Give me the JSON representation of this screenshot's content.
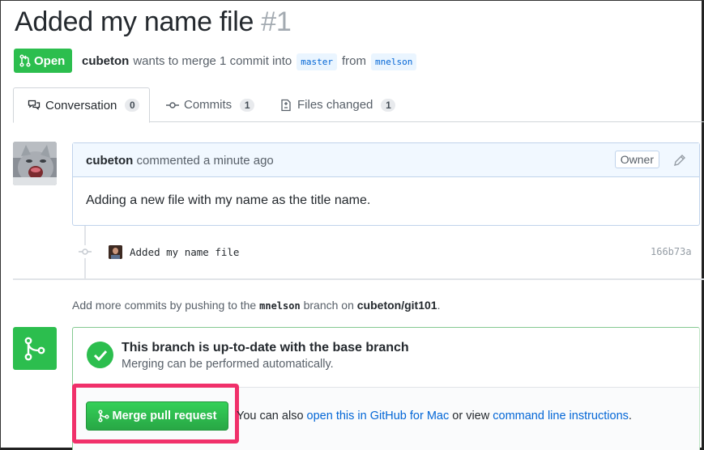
{
  "pr": {
    "title": "Added my name file",
    "number": "#1",
    "state": "Open",
    "author": "cubeton",
    "merge_text": "wants to merge 1 commit into",
    "base_branch": "master",
    "from_text": "from",
    "head_branch": "mnelson"
  },
  "tabs": [
    {
      "label": "Conversation",
      "count": "0",
      "icon": "comment-discussion-icon"
    },
    {
      "label": "Commits",
      "count": "1",
      "icon": "git-commit-icon"
    },
    {
      "label": "Files changed",
      "count": "1",
      "icon": "file-diff-icon"
    }
  ],
  "comment": {
    "author": "cubeton",
    "meta": "commented a minute ago",
    "role": "Owner",
    "body": "Adding a new file with my name as the title name."
  },
  "commit": {
    "message": "Added my name file",
    "sha": "166b73a"
  },
  "hint": {
    "prefix": "Add more commits by pushing to the",
    "branch": "mnelson",
    "middle": "branch on",
    "repo": "cubeton/git101",
    "suffix": "."
  },
  "merge": {
    "title": "This branch is up-to-date with the base branch",
    "subtitle": "Merging can be performed automatically.",
    "button": "Merge pull request",
    "also_prefix": "You can also",
    "link1": "open this in GitHub for Mac",
    "or_view": "or view",
    "link2": "command line instructions",
    "suffix": "."
  },
  "colors": {
    "open_green": "#2cbe4e",
    "link_blue": "#0366d6",
    "highlight_pink": "#f0306a"
  }
}
